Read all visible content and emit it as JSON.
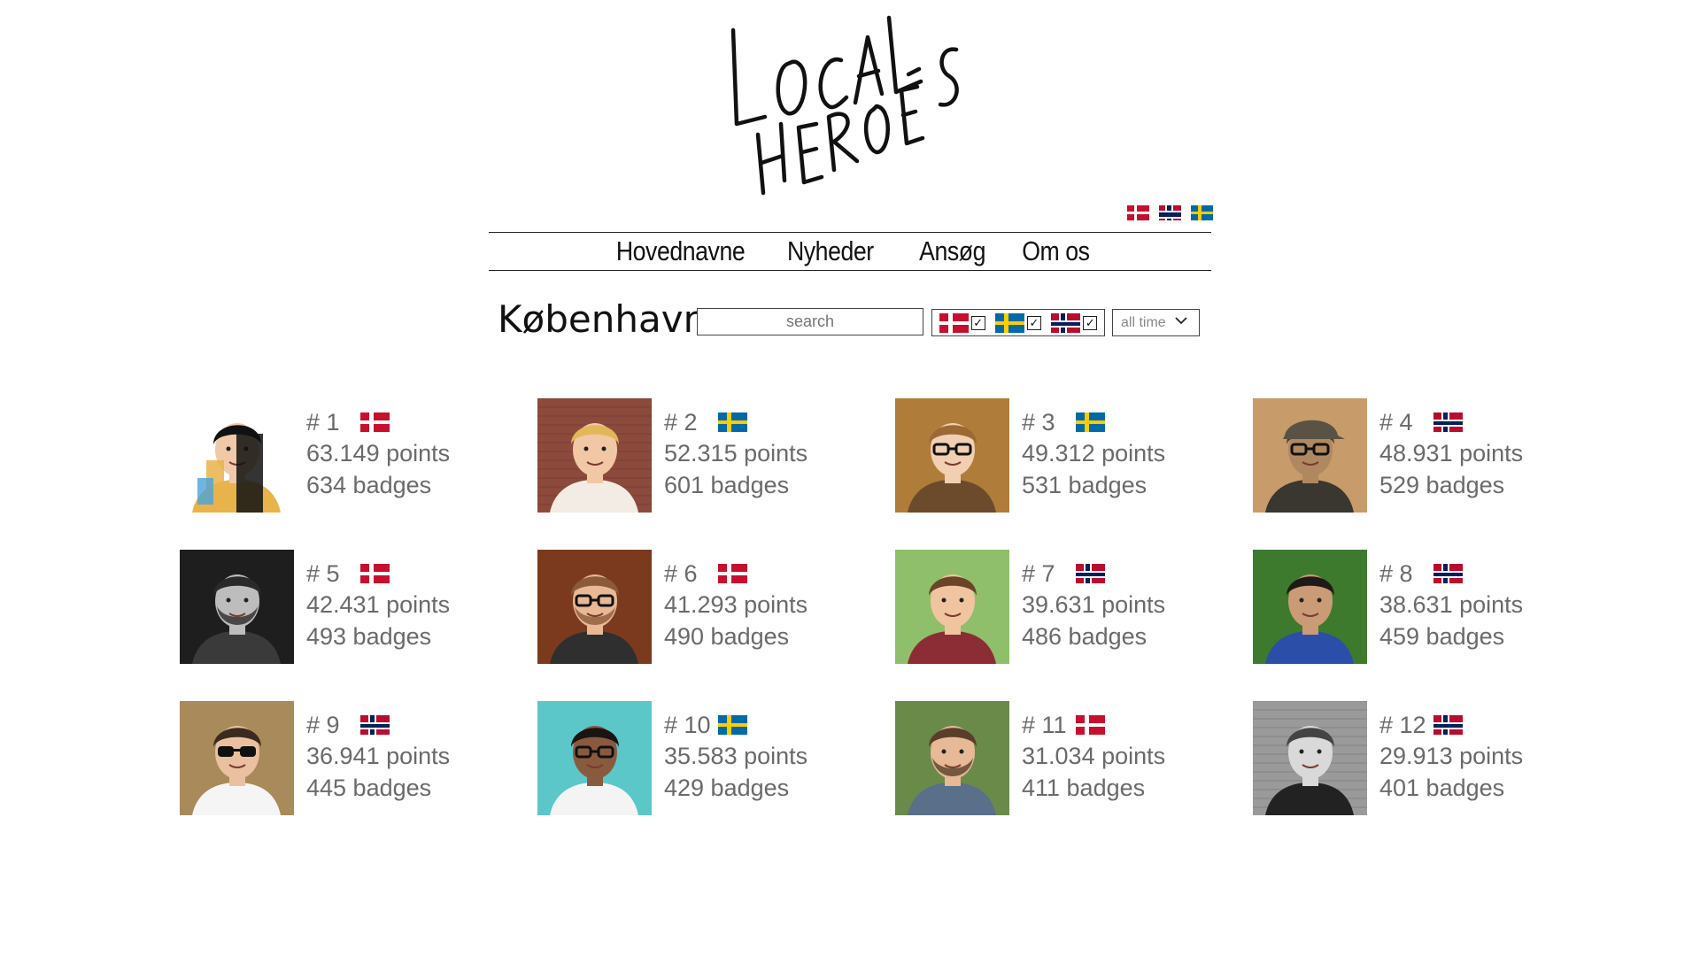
{
  "logo": {
    "text": "LOCAL HEROES",
    "alt": "Local Heroes logo"
  },
  "language_flags": [
    "dk",
    "no",
    "se"
  ],
  "nav": {
    "items": [
      "Hovednavne",
      "Nyheder",
      "Ansøg",
      "Om os"
    ]
  },
  "filter": {
    "city": "København",
    "search_placeholder": "search",
    "countries": [
      {
        "flag": "dk",
        "checked": true
      },
      {
        "flag": "se",
        "checked": true
      },
      {
        "flag": "no",
        "checked": true
      }
    ],
    "time_range": "all time"
  },
  "colors": {
    "dk": "#C8102E",
    "se": "#006AA7",
    "no": "#BA0C2F",
    "text": "#6a6a6a"
  },
  "heroes": [
    {
      "rank": "# 1",
      "flag": "dk",
      "points": "63.149 points",
      "badges": "634 badges",
      "avatar": "illustrated-portrait"
    },
    {
      "rank": "# 2",
      "flag": "se",
      "points": "52.315 points",
      "badges": "601 badges",
      "avatar": "woman-blonde-street"
    },
    {
      "rank": "# 3",
      "flag": "se",
      "points": "49.312 points",
      "badges": "531 badges",
      "avatar": "woman-glasses"
    },
    {
      "rank": "# 4",
      "flag": "no",
      "points": "48.931 points",
      "badges": "529 badges",
      "avatar": "man-cap-glasses"
    },
    {
      "rank": "# 5",
      "flag": "dk",
      "points": "42.431 points",
      "badges": "493 badges",
      "avatar": "man-bw-beard"
    },
    {
      "rank": "# 6",
      "flag": "dk",
      "points": "41.293 points",
      "badges": "490 badges",
      "avatar": "man-glasses-beard"
    },
    {
      "rank": "# 7",
      "flag": "no",
      "points": "39.631 points",
      "badges": "486 badges",
      "avatar": "young-man-smiling"
    },
    {
      "rank": "# 8",
      "flag": "no",
      "points": "38.631 points",
      "badges": "459 badges",
      "avatar": "man-grass"
    },
    {
      "rank": "# 9",
      "flag": "no",
      "points": "36.941 points",
      "badges": "445 badges",
      "avatar": "man-sunglasses"
    },
    {
      "rank": "# 10",
      "flag": "se",
      "points": "35.583 points",
      "badges": "429 badges",
      "avatar": "woman-teal-bg"
    },
    {
      "rank": "# 11",
      "flag": "dk",
      "points": "31.034 points",
      "badges": "411 badges",
      "avatar": "man-smiling-outdoor"
    },
    {
      "rank": "# 12",
      "flag": "no",
      "points": "29.913 points",
      "badges": "401 badges",
      "avatar": "young-man-bw-brick"
    }
  ]
}
